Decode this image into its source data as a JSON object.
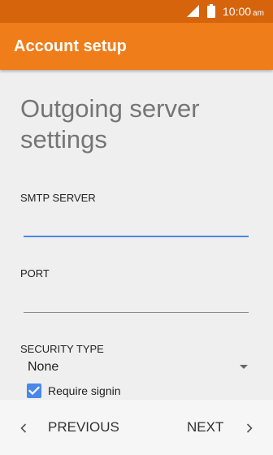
{
  "status_bar": {
    "time": "10:00",
    "ampm": "am",
    "icons": [
      "signal-icon",
      "battery-icon"
    ]
  },
  "action_bar": {
    "title": "Account setup"
  },
  "page": {
    "heading": "Outgoing server settings"
  },
  "form": {
    "smtp_server": {
      "label": "SMTP SERVER",
      "value": ""
    },
    "port": {
      "label": "PORT",
      "value": ""
    },
    "security_type": {
      "label": "SECURITY TYPE",
      "selected": "None"
    },
    "require_signin": {
      "label": "Require signin",
      "checked": true
    }
  },
  "navigation": {
    "previous_label": "PREVIOUS",
    "next_label": "NEXT"
  },
  "colors": {
    "status_bar": "#d5640d",
    "action_bar": "#ef7d1a",
    "accent": "#4a88e8",
    "background": "#efefef"
  }
}
